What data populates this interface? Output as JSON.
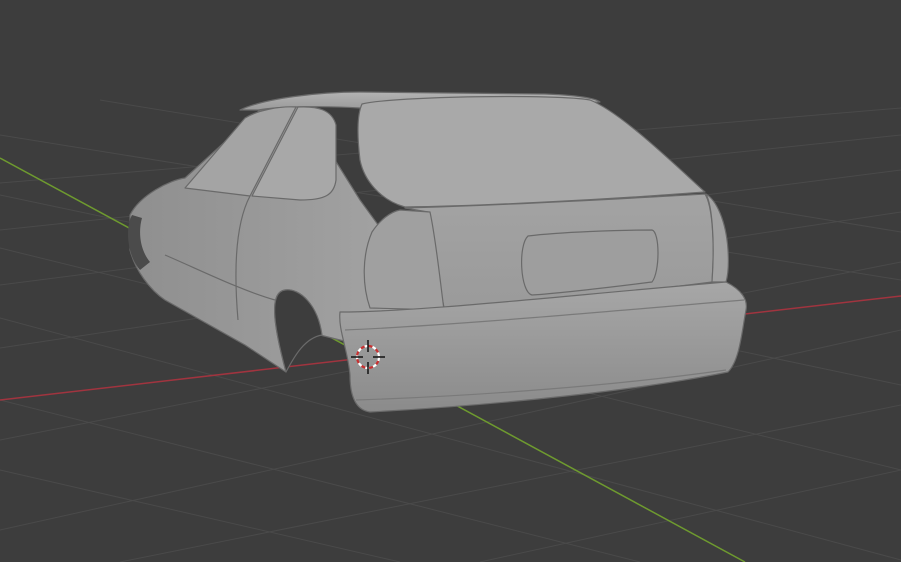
{
  "viewport": {
    "mode": "3d-viewport",
    "shading": "solid",
    "background_color": "#3d3d3d",
    "grid_color": "#4a4a4a",
    "x_axis_color": "#a1343f",
    "y_axis_color": "#6e9a2f",
    "model_color": "#9a9a9a",
    "cursor_colors": [
      "#ffffff",
      "#c83030",
      "#111111"
    ]
  },
  "scene": {
    "object": "car-body",
    "icons": [
      "3d-cursor-icon"
    ]
  }
}
